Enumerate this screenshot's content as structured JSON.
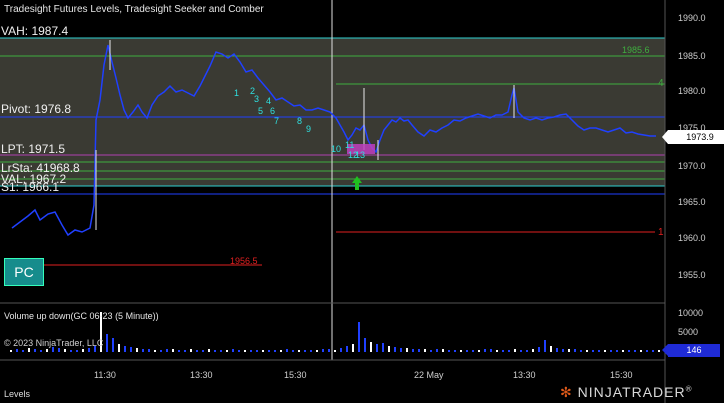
{
  "window": {
    "title": "Tradesight Futures Levels, Tradesight Seeker and Comber",
    "bottom_tab": "Levels",
    "copyright": "© 2023 NinjaTrader, LLC",
    "logo_text_1": "NINJA",
    "logo_text_2": "TRADER",
    "logo_reg": "®"
  },
  "levels": {
    "vah": "VAH: 1987.4",
    "pivot": "Pivot: 1976.8",
    "lpt": "LPT: 1971.5",
    "overlap_text": "LrSta: 41968.8",
    "val": "VAL: 1967.2",
    "s1": "S1: 1966.1",
    "red_level_label": "1956.5",
    "green_level_label": "1985.6"
  },
  "buttons": {
    "pc": "PC"
  },
  "price_axis": {
    "ticks": [
      "1990.0",
      "1985.0",
      "1980.0",
      "1975.0",
      "1970.0",
      "1965.0",
      "1960.0",
      "1955.0"
    ],
    "current_price": "1973.9"
  },
  "volume_panel": {
    "label": "Volume up down(GC 06-23 (5 Minute))",
    "ticks": [
      "10000",
      "5000",
      "0"
    ],
    "current_value": "146"
  },
  "time_axis": {
    "labels": [
      "11:30",
      "13:30",
      "15:30",
      "22 May",
      "13:30",
      "15:30"
    ]
  },
  "seeker_numbers": [
    "1",
    "2",
    "3",
    "4",
    "5",
    "6",
    "7",
    "8",
    "9",
    "10",
    "11",
    "12",
    "13"
  ],
  "chart_marks": {
    "right_red_number": "1",
    "green_marker": "4",
    "mid_label": "1"
  },
  "colors": {
    "background": "#000000",
    "cyan_level": "#2fd0d0",
    "blue_level": "#2040ff",
    "green_level": "#3fae3f",
    "red_level": "#e02020",
    "candle_up": "#2040ff",
    "candle_down": "#ffffff",
    "pc_button": "#168c8c"
  }
}
